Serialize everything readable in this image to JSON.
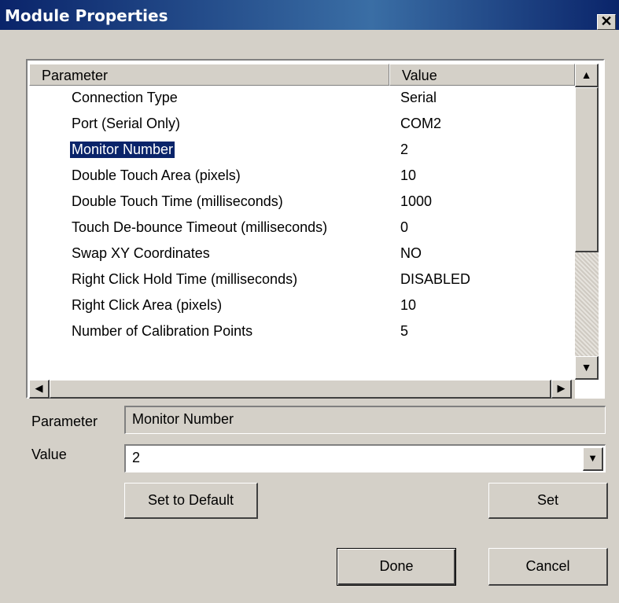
{
  "window": {
    "title": "Module Properties",
    "close_glyph": "✕"
  },
  "list": {
    "columns": [
      "Parameter",
      "Value"
    ],
    "rows": [
      {
        "parameter": "Connection Type",
        "value": "Serial"
      },
      {
        "parameter": "Port (Serial Only)",
        "value": "COM2"
      },
      {
        "parameter": "Monitor Number",
        "value": "2"
      },
      {
        "parameter": "Double Touch Area (pixels)",
        "value": "10"
      },
      {
        "parameter": "Double Touch Time (milliseconds)",
        "value": "1000"
      },
      {
        "parameter": "Touch De-bounce Timeout (milliseconds)",
        "value": "0"
      },
      {
        "parameter": "Swap XY Coordinates",
        "value": "NO"
      },
      {
        "parameter": "Right Click Hold Time (milliseconds)",
        "value": "DISABLED"
      },
      {
        "parameter": "Right Click Area (pixels)",
        "value": "10"
      },
      {
        "parameter": "Number of Calibration Points",
        "value": "5"
      }
    ],
    "selected_index": 2
  },
  "form": {
    "parameter_label": "Parameter",
    "parameter_value": "Monitor Number",
    "value_label": "Value",
    "value_value": "2"
  },
  "buttons": {
    "set_default": "Set to Default",
    "set": "Set",
    "done": "Done",
    "cancel": "Cancel"
  },
  "icons": {
    "scroll_up": "▲",
    "scroll_down": "▼",
    "scroll_left": "◀",
    "scroll_right": "▶",
    "dropdown": "▼"
  },
  "colors": {
    "titlebar": "#0a246a",
    "selection": "#0a246a",
    "dialog_bg": "#d4d0c8"
  }
}
